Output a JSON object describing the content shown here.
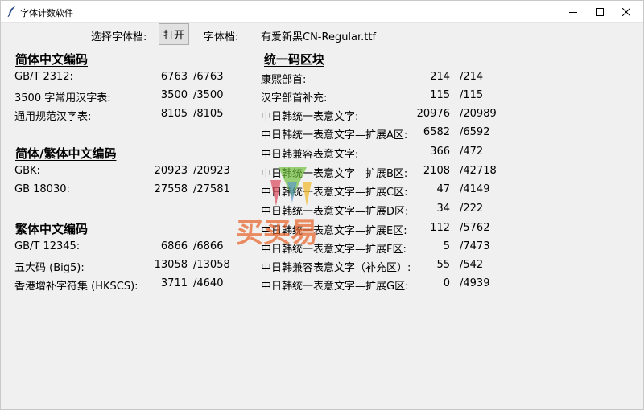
{
  "window": {
    "title": "字体计数软件"
  },
  "toolbar": {
    "select_label": "选择字体档:",
    "open_button": "打开",
    "font_file_label": "字体档:",
    "font_file_name": "有爱新黑CN-Regular.ttf"
  },
  "sections": {
    "simplified": {
      "title": "简体中文编码",
      "rows": [
        {
          "label": "GB/T 2312:",
          "count": "6763",
          "total": "/6763"
        },
        {
          "label": "3500 字常用汉字表:",
          "count": "3500",
          "total": "/3500"
        },
        {
          "label": "通用规范汉字表:",
          "count": "8105",
          "total": "/8105"
        }
      ]
    },
    "simp_trad": {
      "title": "简体/繁体中文编码",
      "rows": [
        {
          "label": "GBK:",
          "count": "20923",
          "total": "/20923"
        },
        {
          "label": "GB 18030:",
          "count": "27558",
          "total": "/27581"
        }
      ]
    },
    "traditional": {
      "title": "繁体中文编码",
      "rows": [
        {
          "label": "GB/T 12345:",
          "count": "6866",
          "total": "/6866"
        },
        {
          "label": "五大码 (Big5):",
          "count": "13058",
          "total": "/13058"
        },
        {
          "label": "香港增补字符集 (HKSCS):",
          "count": "3711",
          "total": "/4640"
        }
      ]
    },
    "unicode": {
      "title": "统一码区块",
      "rows": [
        {
          "label": "康熙部首:",
          "count": "214",
          "total": "/214"
        },
        {
          "label": "汉字部首补充:",
          "count": "115",
          "total": "/115"
        },
        {
          "label": "中日韩统一表意文字:",
          "count": "20976",
          "total": "/20989"
        },
        {
          "label": "中日韩统一表意文字—扩展A区:",
          "count": "6582",
          "total": "/6592"
        },
        {
          "label": "中日韩兼容表意文字:",
          "count": "366",
          "total": "/472"
        },
        {
          "label": "中日韩统一表意文字—扩展B区:",
          "count": "2108",
          "total": "/42718"
        },
        {
          "label": "中日韩统一表意文字—扩展C区:",
          "count": "47",
          "total": "/4149"
        },
        {
          "label": "中日韩统一表意文字—扩展D区:",
          "count": "34",
          "total": "/222"
        },
        {
          "label": "中日韩统一表意文字—扩展E区:",
          "count": "112",
          "total": "/5762"
        },
        {
          "label": "中日韩统一表意文字—扩展F区:",
          "count": "5",
          "total": "/7473"
        },
        {
          "label": "中日韩兼容表意文字（补充区）:",
          "count": "55",
          "total": "/542"
        },
        {
          "label": "中日韩统一表意文字—扩展G区:",
          "count": "0",
          "total": "/4939"
        }
      ]
    }
  },
  "watermark": {
    "text": "买买易"
  },
  "icons": {
    "app": "feather-icon",
    "minimize": "minimize-icon",
    "maximize": "maximize-icon",
    "close": "close-icon"
  }
}
